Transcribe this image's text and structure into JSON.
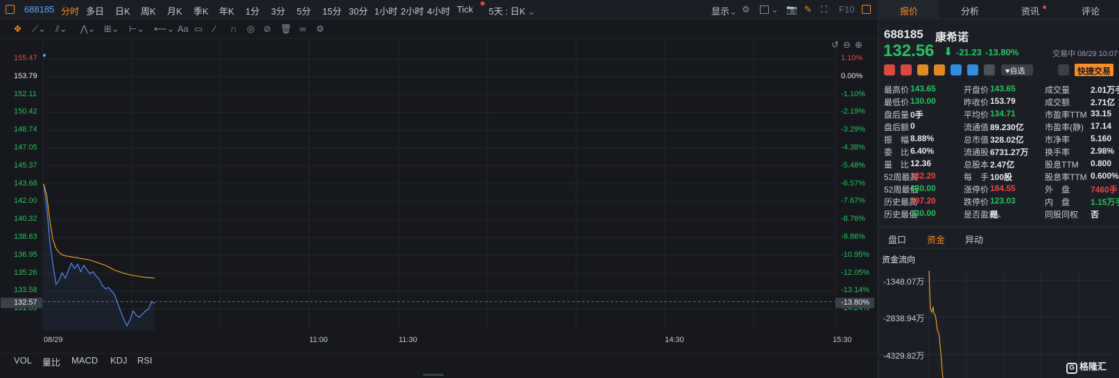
{
  "topbar": {
    "code": "688185",
    "tabs": [
      "分时",
      "多日",
      "日K",
      "周K",
      "月K",
      "季K",
      "年K",
      "1分",
      "3分",
      "5分",
      "15分",
      "30分",
      "1小时",
      "2小时",
      "4小时",
      "Tick",
      "5天 : 日K"
    ],
    "active_tab": "分时",
    "display_label": "显示",
    "f10_label": "F10"
  },
  "toolbar": {
    "text_tool": "Aa"
  },
  "chart": {
    "y_left": [
      "155.47",
      "153.79",
      "152.11",
      "150.42",
      "148.74",
      "147.05",
      "145.37",
      "143.68",
      "142.00",
      "140.32",
      "138.63",
      "136.95",
      "135.26",
      "133.58",
      "131.89"
    ],
    "y_right": [
      "1.10%",
      "0.00%",
      "-1.10%",
      "-2.19%",
      "-3.29%",
      "-4.38%",
      "-5.48%",
      "-6.57%",
      "-7.67%",
      "-8.76%",
      "-9.86%",
      "-10.95%",
      "-12.05%",
      "-13.14%",
      "-14.24%"
    ],
    "current_left": "132.57",
    "current_right": "-13.80%",
    "x_labels": [
      "08/29",
      "11:00",
      "11:30",
      "14:30",
      "15:30"
    ],
    "indicators": [
      "VOL",
      "量比",
      "MACD",
      "KDJ",
      "RSI"
    ],
    "colors": {
      "price_line": "#4f8ff7",
      "avg_line": "#f0a020",
      "up": "#ef4444",
      "down": "#22c55e"
    }
  },
  "chart_data": {
    "type": "line",
    "title": "",
    "series": [
      {
        "values": [
          143.68,
          141.5,
          138.2,
          136.1,
          134.2,
          134.6,
          135.3,
          134.8,
          135.5,
          136.2,
          135.7,
          136.1,
          135.4,
          136.0,
          135.6,
          135.2,
          135.4,
          135.0,
          134.7,
          134.1,
          133.8,
          133.9,
          133.6,
          133.2,
          132.4,
          131.6,
          130.9,
          130.3,
          130.9,
          131.7,
          131.3,
          131.1,
          131.4,
          131.7,
          131.9,
          132.6,
          132.4
        ]
      },
      {
        "values": [
          143.68,
          142.6,
          140.2,
          138.4,
          137.6,
          137.2,
          137.0,
          136.9,
          136.85,
          136.8,
          136.75,
          136.7,
          136.65,
          136.6,
          136.55,
          136.5,
          136.4,
          136.3,
          136.2,
          136.1,
          136.0,
          135.85,
          135.7,
          135.55,
          135.45,
          135.35,
          135.25,
          135.18,
          135.1,
          135.05,
          135.0,
          134.95,
          134.9,
          134.87,
          134.85,
          134.82,
          134.8
        ]
      }
    ],
    "ylim": [
      131.89,
      155.47
    ],
    "y2lim": [
      "-14.24%",
      "1.10%"
    ]
  },
  "panel": {
    "tabs": [
      "报价",
      "分析",
      "资讯",
      "评论"
    ],
    "active_tab": "报价",
    "code": "688185",
    "name": "康希诺",
    "price": "132.56",
    "change": "-21.23",
    "change_pct": "-13.80%",
    "trade_status": "交易中 08/29 10:07",
    "watch_label": "自选",
    "quick_trade": "快捷交易",
    "quotes": [
      [
        {
          "label": "最高价",
          "value": "143.65",
          "color": "green"
        },
        {
          "label": "开盘价",
          "value": "143.65",
          "color": "green"
        },
        {
          "label": "成交量",
          "value": "2.01万手",
          "color": "white"
        }
      ],
      [
        {
          "label": "最低价",
          "value": "130.00",
          "color": "green"
        },
        {
          "label": "昨收价",
          "value": "153.79",
          "color": "white"
        },
        {
          "label": "成交额",
          "value": "2.71亿",
          "color": "white"
        }
      ],
      [
        {
          "label": "盘后量",
          "value": "0手",
          "color": "white"
        },
        {
          "label": "平均价",
          "value": "134.71",
          "color": "green"
        },
        {
          "label": "市盈率TTM",
          "value": "33.15",
          "color": "white"
        }
      ],
      [
        {
          "label": "盘后额",
          "value": "0",
          "color": "white"
        },
        {
          "label": "流通值",
          "value": "89.230亿",
          "color": "white"
        },
        {
          "label": "市盈率(静)",
          "value": "17.14",
          "color": "white"
        }
      ],
      [
        {
          "label": "振　幅",
          "value": "8.88%",
          "color": "white"
        },
        {
          "label": "总市值",
          "value": "328.02亿",
          "color": "white"
        },
        {
          "label": "市净率",
          "value": "5.160",
          "color": "white"
        }
      ],
      [
        {
          "label": "委　比",
          "value": "6.40%",
          "color": "white"
        },
        {
          "label": "流通股",
          "value": "6731.27万",
          "color": "white"
        },
        {
          "label": "换手率",
          "value": "2.98%",
          "color": "white"
        }
      ],
      [
        {
          "label": "量　比",
          "value": "12.36",
          "color": "white"
        },
        {
          "label": "总股本",
          "value": "2.47亿",
          "color": "white"
        },
        {
          "label": "股息TTM",
          "value": "0.800",
          "color": "white"
        }
      ],
      [
        {
          "label": "52周最高",
          "value": "382.20",
          "color": "red"
        },
        {
          "label": "每　手",
          "value": "100股",
          "color": "white"
        },
        {
          "label": "股息率TTM",
          "value": "0.600%",
          "color": "white"
        }
      ],
      [
        {
          "label": "52周最低",
          "value": "130.00",
          "color": "green"
        },
        {
          "label": "涨停价",
          "value": "184.55",
          "color": "red"
        },
        {
          "label": "外　盘",
          "value": "7460手",
          "color": "red"
        }
      ],
      [
        {
          "label": "历史最高",
          "value": "797.20",
          "color": "red"
        },
        {
          "label": "跌停价",
          "value": "123.03",
          "color": "green"
        },
        {
          "label": "内　盘",
          "value": "1.15万手",
          "color": "green"
        }
      ],
      [
        {
          "label": "历史最低",
          "value": "130.00",
          "color": "green"
        },
        {
          "label": "是否盈利",
          "value": "是",
          "color": "white"
        },
        {
          "label": "同股同权",
          "value": "否",
          "color": "white"
        }
      ]
    ],
    "subtabs": [
      "盘口",
      "资金",
      "异动"
    ],
    "active_subtab": "资金",
    "flow_title": "资金流向",
    "flow_labels": [
      "-1348.07万",
      "-2838.94万",
      "-4329.82万"
    ],
    "logo_text": "格隆汇"
  }
}
